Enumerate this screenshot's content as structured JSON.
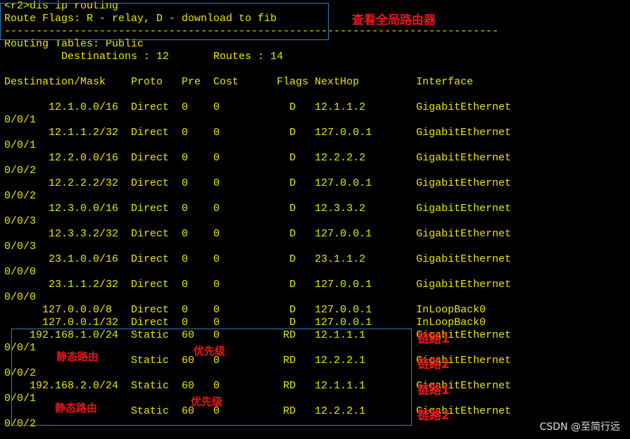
{
  "terminal": {
    "lines": [
      "<r2>dis ip routing",
      "Route Flags: R - relay, D - download to fib",
      "------------------------------------------------------------------------------",
      "Routing Tables: Public",
      "         Destinations : 12       Routes : 14",
      "",
      "Destination/Mask    Proto   Pre  Cost      Flags NextHop         Interface",
      "",
      "       12.1.0.0/16  Direct  0    0           D   12.1.1.2        GigabitEthernet",
      "0/0/1",
      "       12.1.1.2/32  Direct  0    0           D   127.0.0.1       GigabitEthernet",
      "0/0/1",
      "       12.2.0.0/16  Direct  0    0           D   12.2.2.2        GigabitEthernet",
      "0/0/2",
      "       12.2.2.2/32  Direct  0    0           D   127.0.0.1       GigabitEthernet",
      "0/0/2",
      "       12.3.0.0/16  Direct  0    0           D   12.3.3.2        GigabitEthernet",
      "0/0/3",
      "       12.3.3.2/32  Direct  0    0           D   127.0.0.1       GigabitEthernet",
      "0/0/3",
      "       23.1.0.0/16  Direct  0    0           D   23.1.1.2        GigabitEthernet",
      "0/0/0",
      "       23.1.1.2/32  Direct  0    0           D   127.0.0.1       GigabitEthernet",
      "0/0/0",
      "      127.0.0.0/8   Direct  0    0           D   127.0.0.1       InLoopBack0",
      "      127.0.0.1/32  Direct  0    0           D   127.0.0.1       InLoopBack0",
      "    192.168.1.0/24  Static  60   0          RD   12.1.1.1        GigabitEthernet",
      "0/0/1",
      "                    Static  60   0          RD   12.2.2.1        GigabitEthernet",
      "0/0/2",
      "    192.168.2.0/24  Static  60   0          RD   12.1.1.1        GigabitEthernet",
      "0/0/1",
      "                    Static  60   0          RD   12.2.2.1        GigabitEthernet",
      "0/0/2"
    ]
  },
  "annotations": {
    "global_routing": "查看全局路由器",
    "static_route_1": "静态路由",
    "priority_1": "优先级",
    "link1_a": "链路1",
    "link2_a": "链路2",
    "static_route_2": "静态路由",
    "priority_2": "优先级",
    "link1_b": "链路1",
    "link2_b": "链路2"
  },
  "watermark": "CSDN @至简行远",
  "colors": {
    "background": "#000000",
    "terminal_text": "#e9e600",
    "annotation": "#e8161b",
    "highlight_box": "#2f7fb8"
  }
}
